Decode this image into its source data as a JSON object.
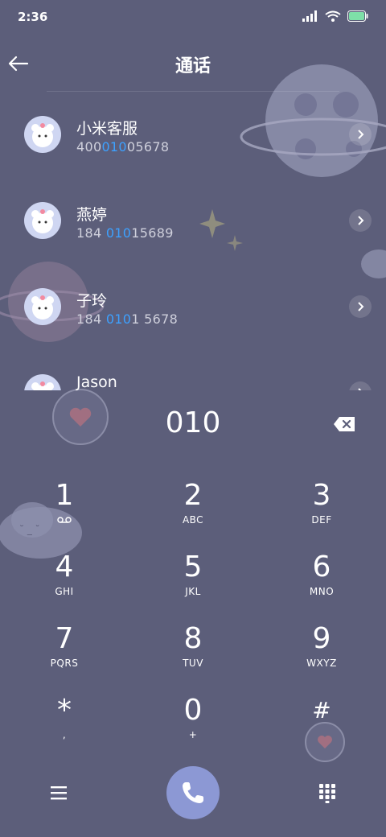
{
  "status_bar": {
    "time": "2:36"
  },
  "header": {
    "title": "通话"
  },
  "contacts": [
    {
      "name": "小米客服",
      "number_pre": "400",
      "number_match": "010",
      "number_post": "05678"
    },
    {
      "name": "燕婷",
      "number_pre": "184 ",
      "number_match": "010",
      "number_post": "15689"
    },
    {
      "name": "子玲",
      "number_pre": "184 ",
      "number_match": "010",
      "number_post": "1 5678"
    },
    {
      "name": "Jason"
    }
  ],
  "dial_input": {
    "value": "010"
  },
  "keypad": [
    {
      "digit": "1",
      "letters": ""
    },
    {
      "digit": "2",
      "letters": "ABC"
    },
    {
      "digit": "3",
      "letters": "DEF"
    },
    {
      "digit": "4",
      "letters": "GHI"
    },
    {
      "digit": "5",
      "letters": "JKL"
    },
    {
      "digit": "6",
      "letters": "MNO"
    },
    {
      "digit": "7",
      "letters": "PQRS"
    },
    {
      "digit": "8",
      "letters": "TUV"
    },
    {
      "digit": "9",
      "letters": "WXYZ"
    },
    {
      "digit": "*",
      "letters": ","
    },
    {
      "digit": "0",
      "letters": "+"
    },
    {
      "digit": "#",
      "letters": ""
    }
  ],
  "icons": {
    "back": "arrow-left-icon",
    "chevron": "chevron-right-icon",
    "backspace": "backspace-icon",
    "voicemail": "voicemail-icon",
    "menu": "menu-icon",
    "call": "phone-icon",
    "dialpad": "dialpad-icon"
  },
  "colors": {
    "background": "#5c5e7a",
    "match_highlight": "#3da1ff",
    "call_button": "#8c98d4"
  }
}
